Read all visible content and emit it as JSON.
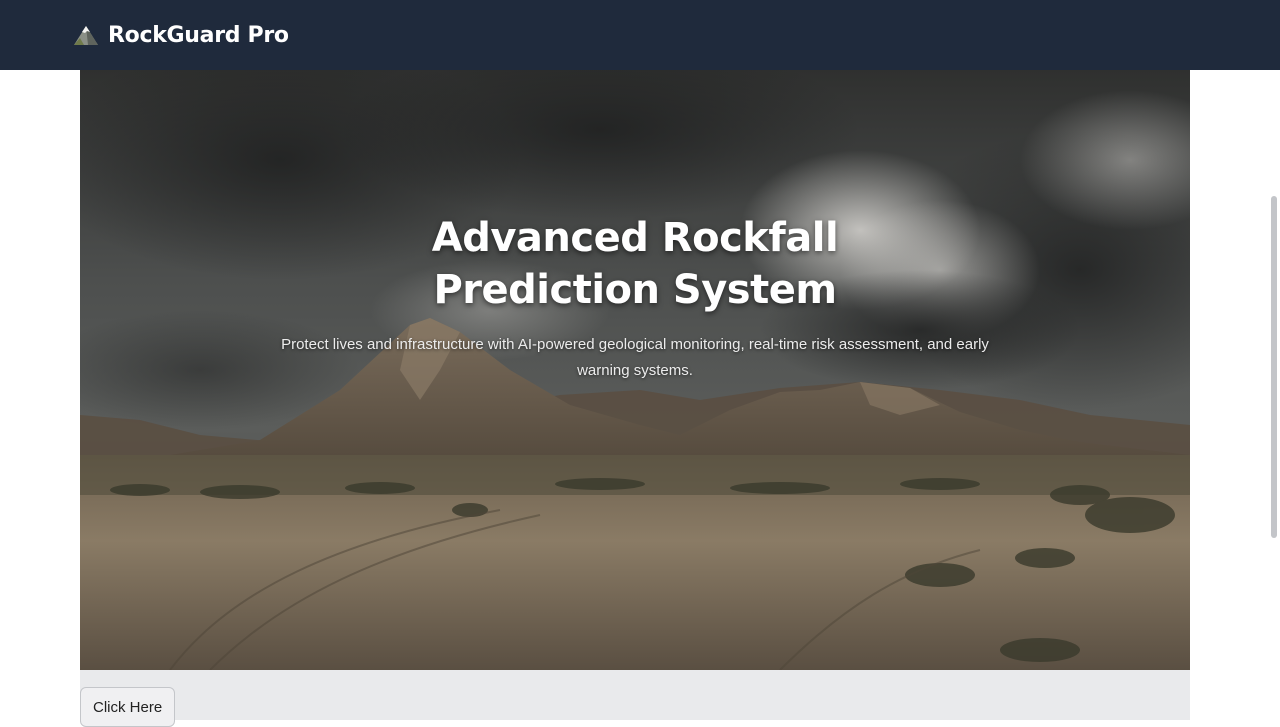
{
  "app": {
    "name": "RockGuard Pro",
    "logo_icon": "mountain-icon"
  },
  "hero": {
    "title": "Advanced Rockfall Prediction System",
    "subtitle": "Protect lives and infrastructure with AI-powered geological monitoring, real-time risk assessment, and early warning systems.",
    "image_icon": "stormy-desert-mountains-image"
  },
  "cta": {
    "label": "Click Here"
  },
  "colors": {
    "navbar": "#1f2a3c",
    "content_bg": "#e9eaec",
    "button_bg": "#f0f0f2"
  }
}
